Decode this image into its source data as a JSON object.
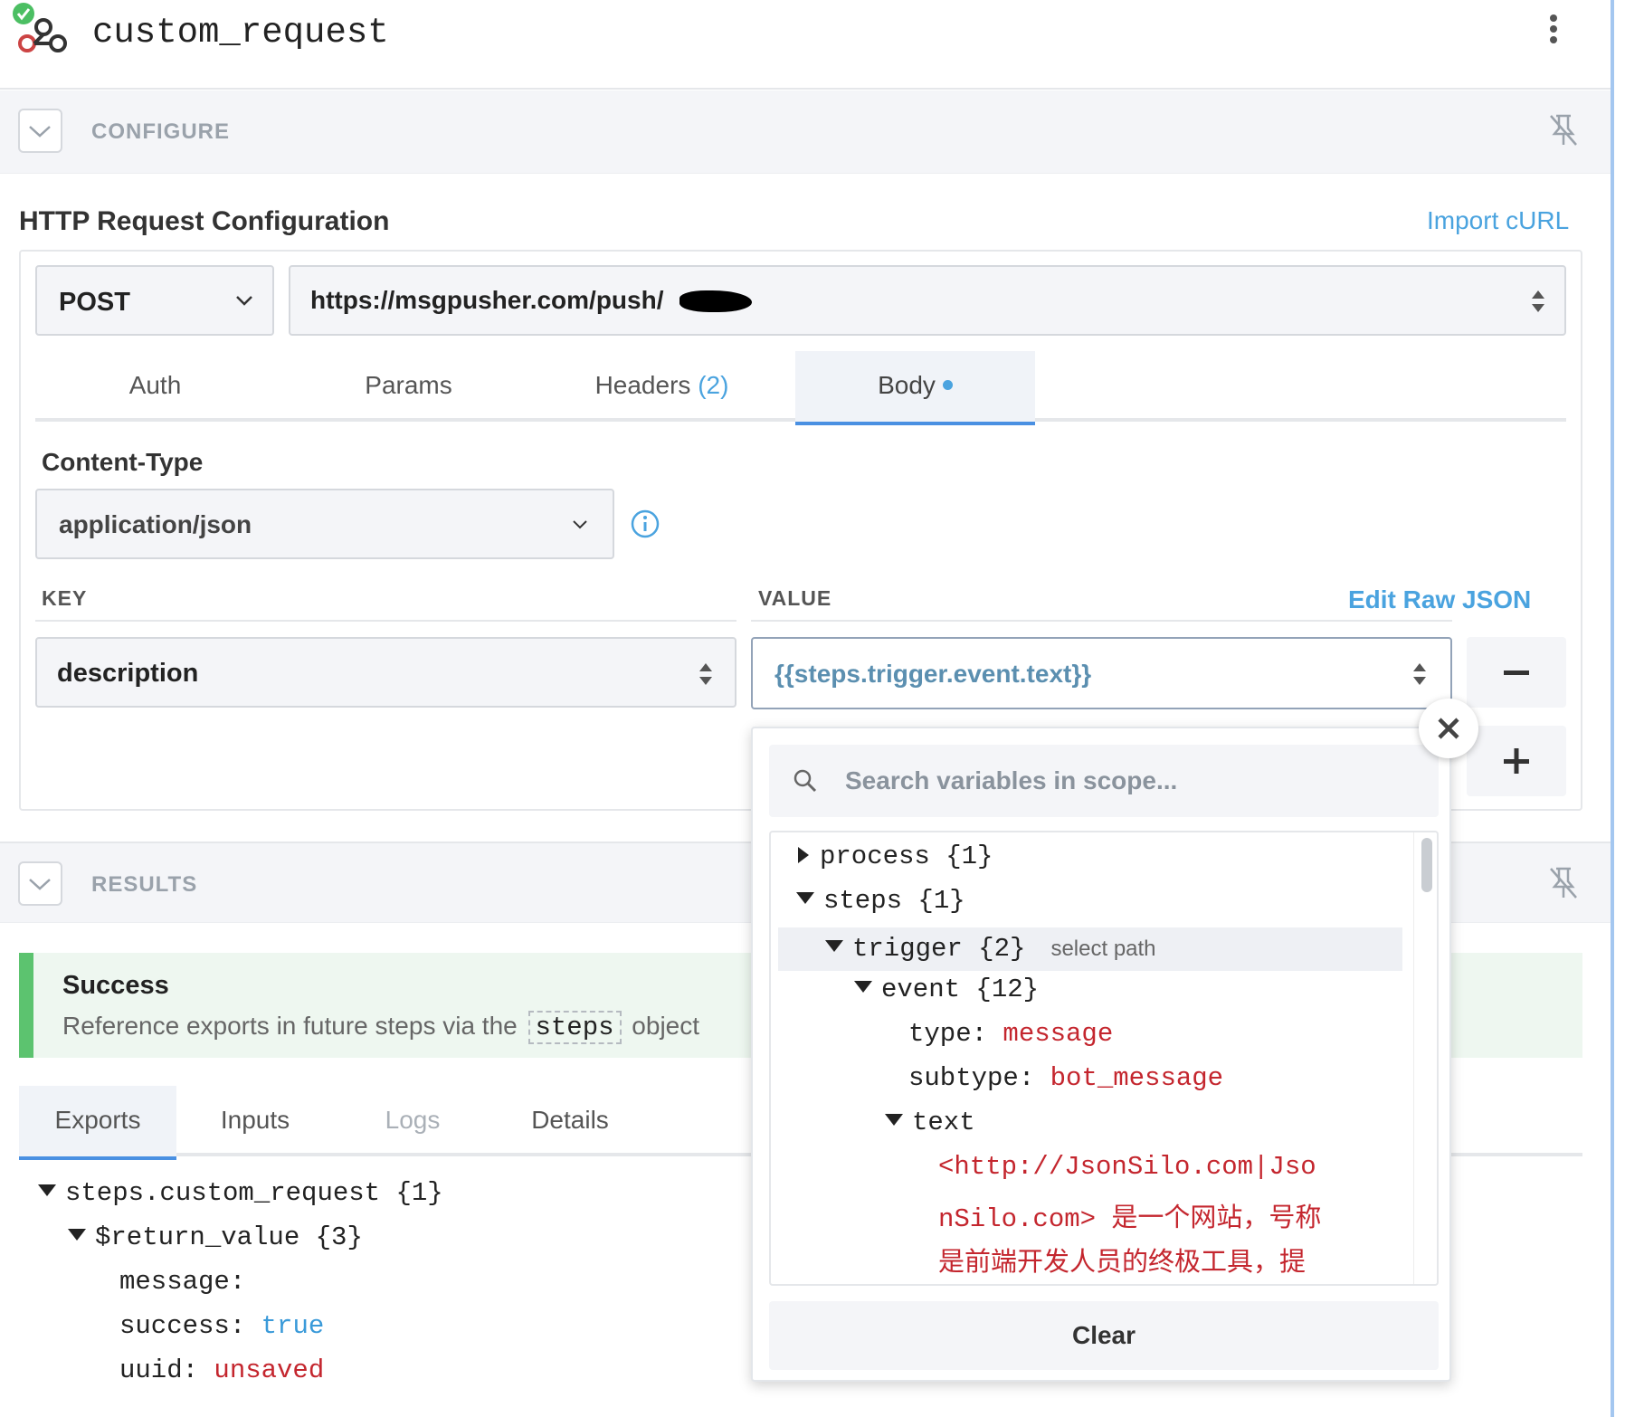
{
  "header": {
    "title": "custom_request"
  },
  "configure": {
    "section_label": "CONFIGURE",
    "heading": "HTTP Request Configuration",
    "import_curl": "Import cURL",
    "method": "POST",
    "url": "https://msgpusher.com/push/",
    "tabs": [
      {
        "label": "Auth"
      },
      {
        "label": "Params"
      },
      {
        "label": "Headers",
        "count": "(2)"
      },
      {
        "label": "Body"
      }
    ],
    "content_type_label": "Content-Type",
    "content_type": "application/json",
    "key_header": "KEY",
    "value_header": "VALUE",
    "edit_raw_json": "Edit Raw JSON",
    "row": {
      "key": "description",
      "value": "{{steps.trigger.event.text}}"
    }
  },
  "variables_popup": {
    "search_placeholder": "Search variables in scope...",
    "tree": [
      {
        "name": "process",
        "count": "{1}",
        "state": "collapsed"
      },
      {
        "name": "steps",
        "count": "{1}",
        "state": "expanded"
      },
      {
        "name": "trigger",
        "count": "{2}",
        "state": "expanded",
        "hint": "select path"
      },
      {
        "name": "event",
        "count": "{12}",
        "state": "expanded"
      },
      {
        "key": "type:",
        "value": "message"
      },
      {
        "key": "subtype:",
        "value": "bot_message"
      },
      {
        "name": "text",
        "state": "expanded"
      }
    ],
    "text_lines": [
      "<http://JsonSilo.com|Jso",
      "nSilo.com> 是一个网站，号称",
      "是前端开发人员的终极工具，提"
    ],
    "clear": "Clear"
  },
  "results": {
    "section_label": "RESULTS",
    "success_title": "Success",
    "success_prefix": "Reference exports in future steps via the",
    "success_code": "steps",
    "success_suffix": "object",
    "tabs": [
      "Exports",
      "Inputs",
      "Logs",
      "Details"
    ],
    "exports": {
      "root": "steps.custom_request {1}",
      "return_value": "$return_value {3}",
      "message_key": "message:",
      "success_key": "success:",
      "success_val": "true",
      "uuid_key": "uuid:",
      "uuid_val": "unsaved"
    }
  },
  "colors": {
    "accent": "#4aa3df",
    "success": "#5cc36f",
    "value_red": "#c4262e"
  }
}
